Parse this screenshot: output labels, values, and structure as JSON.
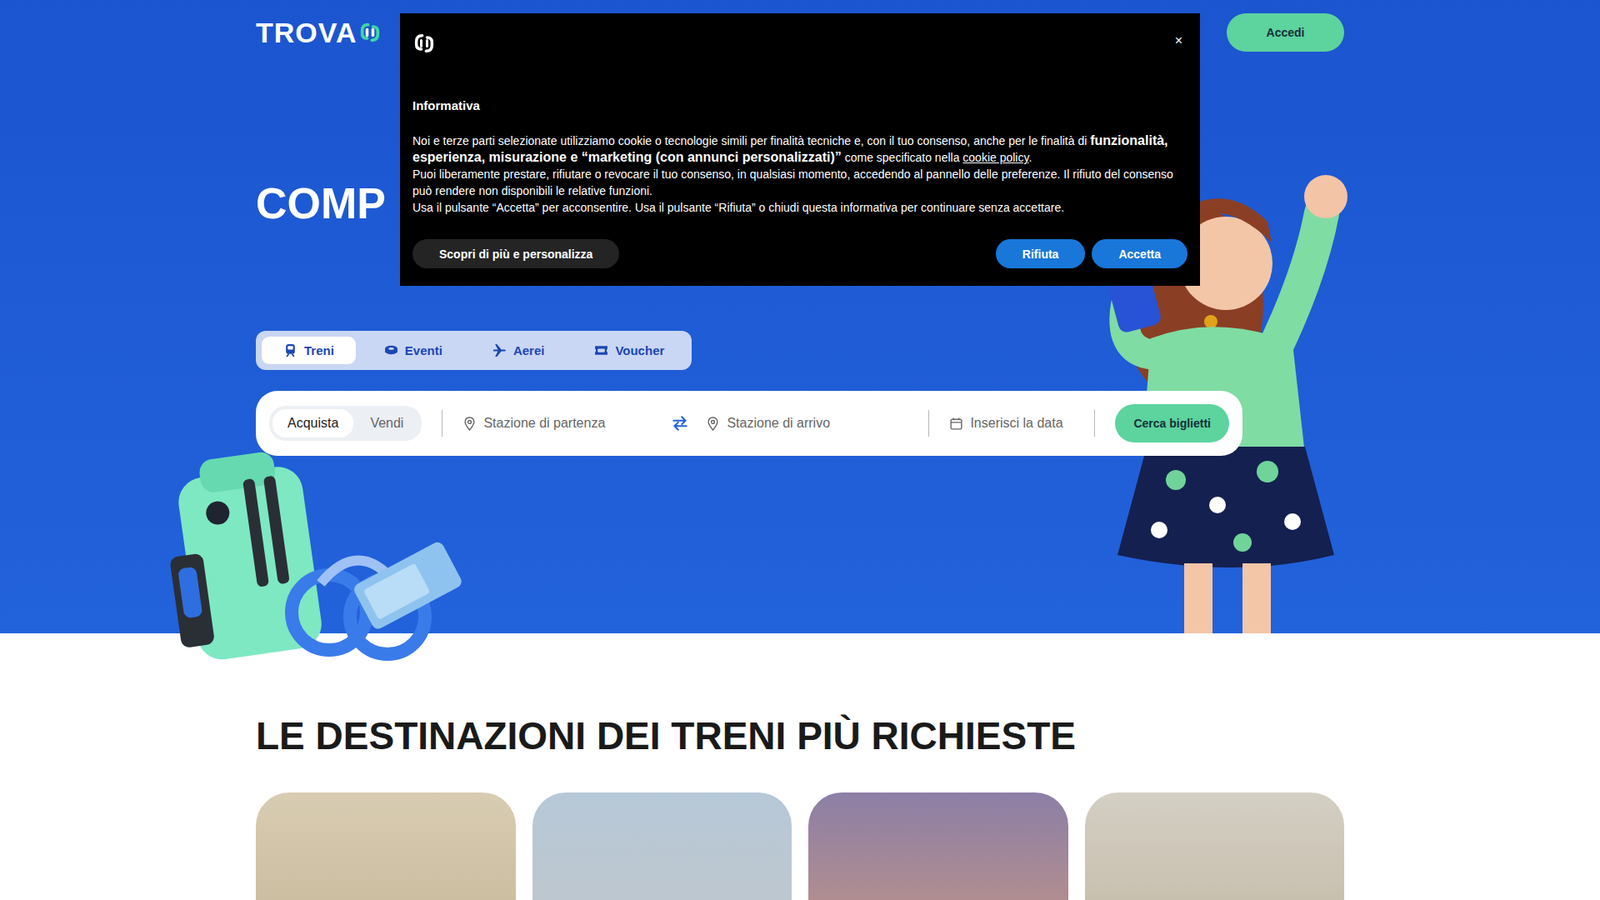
{
  "header": {
    "logo": "TROVA",
    "login_button": "Accedi"
  },
  "hero": {
    "title": "COMP"
  },
  "category_tabs": [
    {
      "label": "Treni",
      "selected": true,
      "kind": "train"
    },
    {
      "label": "Eventi",
      "selected": false,
      "kind": "event"
    },
    {
      "label": "Aerei",
      "selected": false,
      "kind": "plane"
    },
    {
      "label": "Voucher",
      "selected": false,
      "kind": "voucher"
    }
  ],
  "search": {
    "modes": [
      {
        "label": "Acquista",
        "selected": true
      },
      {
        "label": "Vendi",
        "selected": false
      }
    ],
    "departure_placeholder": "Stazione di partenza",
    "arrival_placeholder": "Stazione di arrivo",
    "date_placeholder": "Inserisci la data",
    "submit": "Cerca biglietti"
  },
  "section": {
    "title": "LE DESTINAZIONI DEI TRENI PIÙ RICHIESTE"
  },
  "cookie_dialog": {
    "close": "×",
    "title": "Informativa",
    "paragraphs": [
      [
        {
          "text": "Noi e terze parti selezionate utilizziamo cookie o tecnologie simili per finalità tecniche e, con il tuo consenso, anche per le finalità di ",
          "kind": "plain"
        },
        {
          "text": "funzionalità, esperienza, misurazione e “marketing (con annunci personalizzati)”",
          "kind": "bold"
        },
        {
          "text": " come specificato nella ",
          "kind": "plain"
        },
        {
          "text": "cookie policy",
          "kind": "link"
        },
        {
          "text": ".",
          "kind": "plain"
        }
      ],
      [
        {
          "text": "Puoi liberamente prestare, rifiutare o revocare il tuo consenso, in qualsiasi momento, accedendo al pannello delle preferenze. Il rifiuto del consenso può rendere non disponibili le relative funzioni.",
          "kind": "plain"
        }
      ],
      [
        {
          "text": "Usa il pulsante “Accetta” per acconsentire. Usa il pulsante “Rifiuta” o chiudi questa informativa per continuare senza accettare.",
          "kind": "plain"
        }
      ]
    ],
    "buttons": [
      {
        "label": "Scopri di più e personalizza",
        "kind": "secondary"
      },
      {
        "label": "Rifiuta",
        "kind": "primary"
      },
      {
        "label": "Accetta",
        "kind": "primary"
      }
    ]
  }
}
